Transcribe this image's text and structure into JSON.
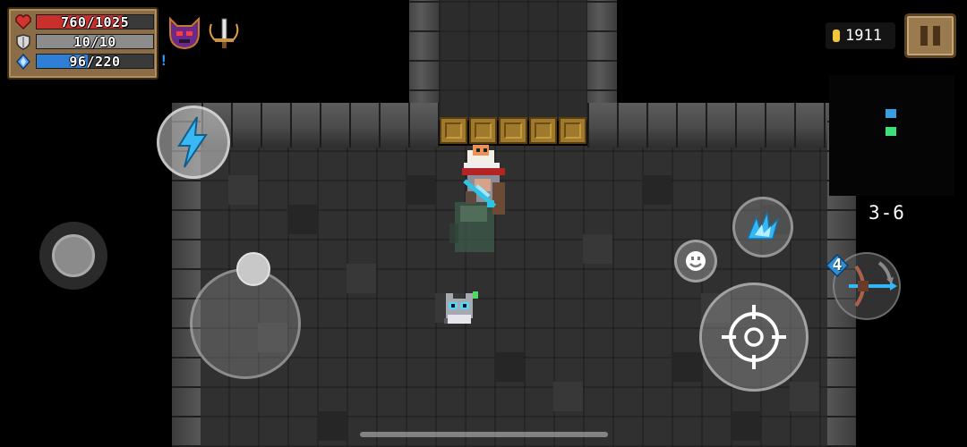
{
  "hud": {
    "hp": {
      "text": "760/1025",
      "current": 760,
      "max": 1025,
      "color": "#c9302c",
      "icon": "heart-icon"
    },
    "armor": {
      "text": "10/10",
      "current": 10,
      "max": 10,
      "color": "#8c8c8c",
      "icon": "shield-icon"
    },
    "energy": {
      "text": "96/220",
      "current": 96,
      "max": 220,
      "color": "#2f7fd6",
      "icon": "energy-crystal-icon"
    },
    "buffs": [
      {
        "icon": "demon-helmet-buff-icon"
      },
      {
        "icon": "sword-buff-icon"
      }
    ],
    "alert": "!"
  },
  "coins": {
    "value": "1911",
    "icon": "gold-coin-icon"
  },
  "pause": {
    "icon": "pause-icon"
  },
  "level": "3-6",
  "controls": {
    "skill": "lightning-skill-icon",
    "emote": "smiley-icon",
    "special": "ice-burst-icon",
    "attack": "crosshair-icon",
    "weapon": {
      "icon": "crossbow-icon",
      "energy_cost": "4",
      "swap": "swap-arrow-icon"
    }
  },
  "colors": {
    "gold": "#f5c638",
    "panel": "#8a6d47",
    "door": "#a07a2c"
  }
}
